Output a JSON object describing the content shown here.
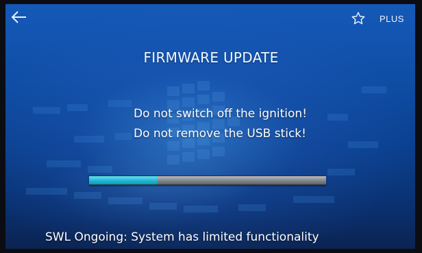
{
  "header": {
    "back_icon": "arrow-left-icon",
    "favorite_icon": "star-outline-icon",
    "plus_label": "PLUS"
  },
  "main": {
    "title": "FIRMWARE UPDATE",
    "warnings": [
      "Do not switch off the ignition!",
      "Do not remove the USB stick!"
    ],
    "progress": 0.29
  },
  "footer": {
    "status_text": "SWL Ongoing: System has limited functionality"
  },
  "colors": {
    "background": "#0f4ea6",
    "progress_fill": "#1fb6d6",
    "progress_track": "#8a8f96",
    "text": "#ffffff"
  }
}
